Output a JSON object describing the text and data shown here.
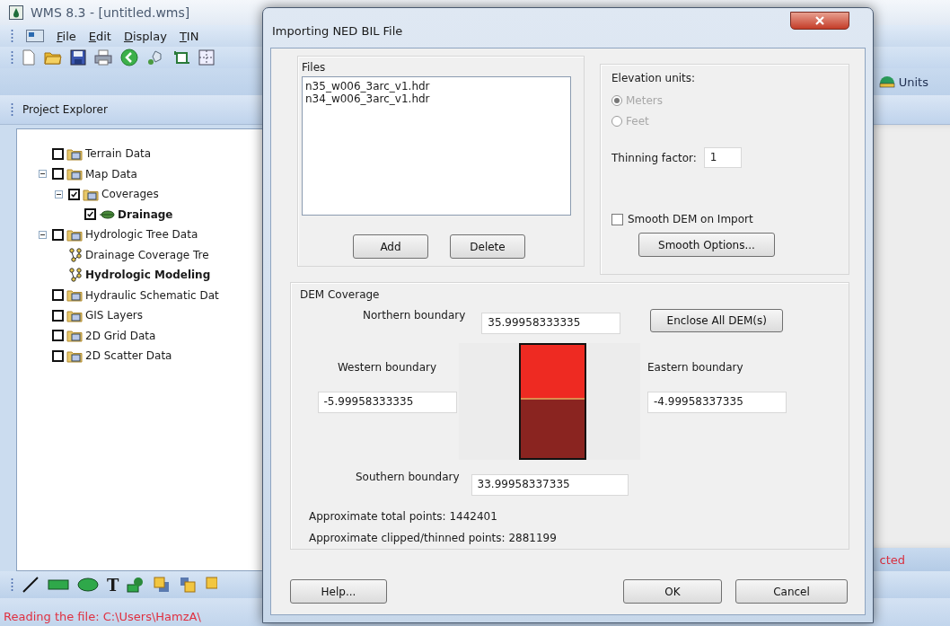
{
  "main_window": {
    "title": "WMS 8.3 - [untitled.wms]",
    "menu": [
      "File",
      "Edit",
      "Display",
      "TIN"
    ],
    "units_button": "Units",
    "panel_title": "Project Explorer",
    "tree": [
      {
        "kind": "layer",
        "label": "Terrain Data",
        "checked": false,
        "active": false
      },
      {
        "kind": "layer",
        "label": "Map Data",
        "checked": false,
        "active": false,
        "expanded": true,
        "children": [
          {
            "kind": "layer",
            "label": "Coverages",
            "checked": true,
            "active": false,
            "expanded": true,
            "children": [
              {
                "kind": "coverage",
                "label": "Drainage",
                "checked": true,
                "active": true
              }
            ]
          }
        ]
      },
      {
        "kind": "layer",
        "label": "Hydrologic Tree Data",
        "checked": false,
        "active": false,
        "expanded": true,
        "children": [
          {
            "kind": "model",
            "label": "Drainage Coverage Tre",
            "active": false
          },
          {
            "kind": "model",
            "label": "Hydrologic Modeling",
            "active": true
          }
        ]
      },
      {
        "kind": "layer",
        "label": "Hydraulic Schematic Dat",
        "checked": false,
        "active": false
      },
      {
        "kind": "layer",
        "label": "GIS Layers",
        "checked": false,
        "active": false
      },
      {
        "kind": "layer",
        "label": "2D Grid Data",
        "checked": false,
        "active": false
      },
      {
        "kind": "layer",
        "label": "2D Scatter Data",
        "checked": false,
        "active": false
      }
    ],
    "text_tool": "T",
    "strip_text": "cted",
    "status_bar": "Reading the file: C:\\Users\\HamzA\\"
  },
  "dialog": {
    "title": "Importing NED BIL File",
    "files_label": "Files",
    "files": [
      "n35_w006_3arc_v1.hdr",
      "n34_w006_3arc_v1.hdr"
    ],
    "add_button": "Add",
    "delete_button": "Delete",
    "elevation_label": "Elevation units:",
    "units_disabled": true,
    "units": [
      {
        "label": "Meters",
        "selected": true
      },
      {
        "label": "Feet",
        "selected": false
      }
    ],
    "thinning_label": "Thinning factor:",
    "thinning_value": "1",
    "smooth_dem": {
      "label": "Smooth DEM on Import",
      "checked": false
    },
    "smooth_options_button": "Smooth Options...",
    "coverage_label": "DEM Coverage",
    "north": {
      "label": "Northern boundary",
      "value": "35.99958333335"
    },
    "enclose_button": "Enclose All DEM(s)",
    "west": {
      "label": "Western boundary",
      "value": "-5.99958333335"
    },
    "east": {
      "label": "Eastern boundary",
      "value": "-4.99958337335"
    },
    "south": {
      "label": "Southern boundary",
      "value": "33.99958337335"
    },
    "total_points": "Approximate total points: 1442401",
    "clipped_points": "Approximate clipped/thinned points: 2881199",
    "help_button": "Help...",
    "ok_button": "OK",
    "cancel_button": "Cancel"
  }
}
